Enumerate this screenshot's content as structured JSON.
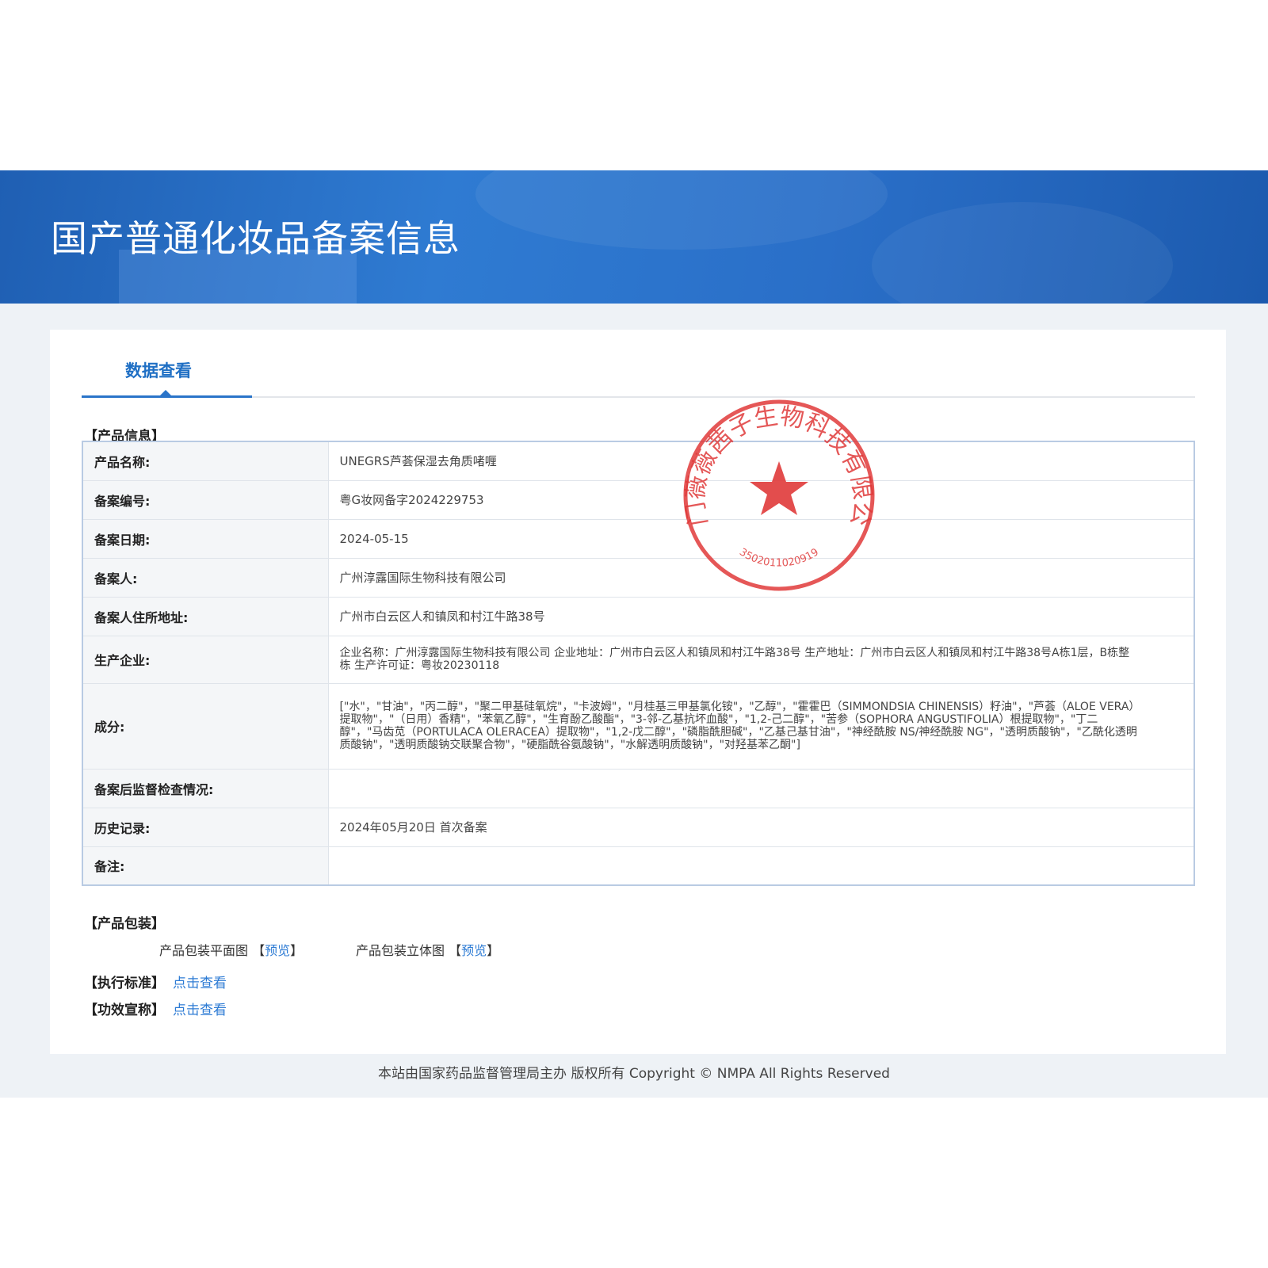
{
  "header": {
    "title": "国产普通化妆品备案信息"
  },
  "tab": {
    "label": "数据查看"
  },
  "sections": {
    "product_info": "【产品信息】",
    "packaging": "【产品包装】",
    "standard": "【执行标准】",
    "efficacy": "【功效宣称】"
  },
  "rows": [
    {
      "label": "产品名称:",
      "value": "UNEGRS芦荟保湿去角质啫喱"
    },
    {
      "label": "备案编号:",
      "value": "粤G妆网备字2024229753"
    },
    {
      "label": "备案日期:",
      "value": "2024-05-15"
    },
    {
      "label": "备案人:",
      "value": "广州淳露国际生物科技有限公司"
    },
    {
      "label": "备案人住所地址:",
      "value": "广州市白云区人和镇凤和村江牛路38号"
    },
    {
      "label": "生产企业:",
      "value": "企业名称：广州淳露国际生物科技有限公司 企业地址：广州市白云区人和镇凤和村江牛路38号 生产地址：广州市白云区人和镇凤和村江牛路38号A栋1层，B栋整栋 生产许可证：粤妆20230118"
    },
    {
      "label": "成分:",
      "value": "[\"水\"，\"甘油\"，\"丙二醇\"，\"聚二甲基硅氧烷\"，\"卡波姆\"，\"月桂基三甲基氯化铵\"，\"乙醇\"，\"霍霍巴（SIMMONDSIA CHINENSIS）籽油\"，\"芦荟（ALOE VERA）提取物\"，\"（日用）香精\"，\"苯氧乙醇\"，\"生育酚乙酸酯\"，\"3-邻-乙基抗坏血酸\"，\"1,2-己二醇\"，\"苦参（SOPHORA ANGUSTIFOLIA）根提取物\"，\"丁二醇\"，\"马齿苋（PORTULACA OLERACEA）提取物\"，\"1,2-戊二醇\"，\"磷脂酰胆碱\"，\"乙基己基甘油\"，\"神经酰胺 NS/神经酰胺 NG\"，\"透明质酸钠\"，\"乙酰化透明质酸钠\"，\"透明质酸钠交联聚合物\"，\"硬脂酰谷氨酸钠\"，\"水解透明质酸钠\"，\"对羟基苯乙酮\"]"
    },
    {
      "label": "备案后监督检查情况:",
      "value": ""
    },
    {
      "label": "历史记录:",
      "value": "2024年05月20日 首次备案"
    },
    {
      "label": "备注:",
      "value": ""
    }
  ],
  "packaging": {
    "flat_label": "产品包装平面图",
    "flat_link": "预览",
    "solid_label": "产品包装立体图",
    "solid_link": "预览",
    "bracket_open": "【",
    "bracket_close": "】"
  },
  "links": {
    "standard": "点击查看",
    "efficacy": "点击查看"
  },
  "seal": {
    "company": "厦门薇薇茜子生物科技有限公司",
    "number": "3502011020919"
  },
  "footer": {
    "text": "本站由国家药品监督管理局主办 版权所有 Copyright © NMPA All Rights Reserved"
  },
  "colors": {
    "banner": "#2a6fc8",
    "accent": "#2a74c9",
    "link": "#2d7bd4",
    "seal": "#e03a3a"
  }
}
